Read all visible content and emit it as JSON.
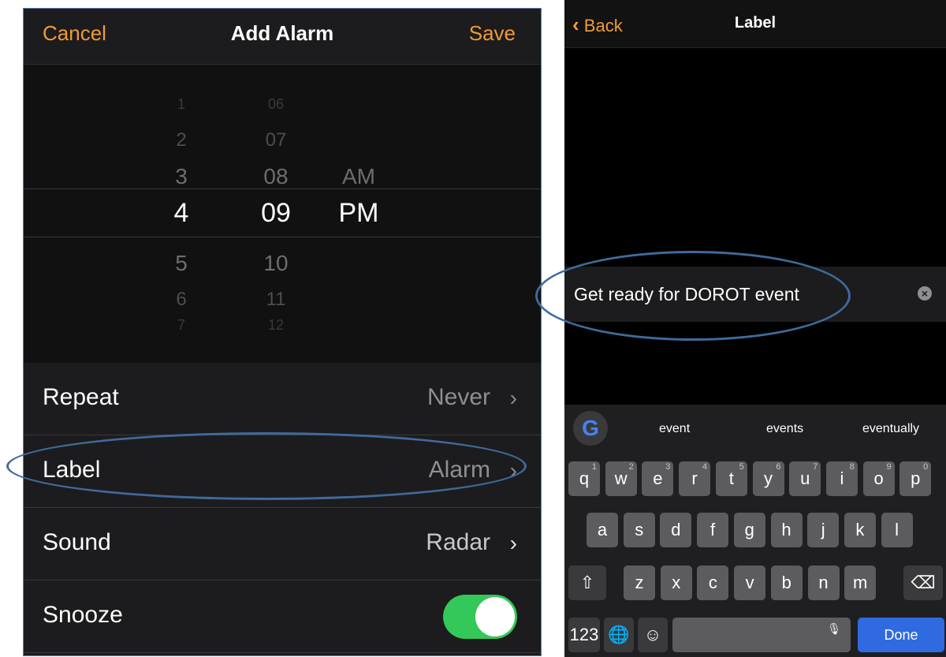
{
  "left": {
    "nav": {
      "cancel": "Cancel",
      "title": "Add Alarm",
      "save": "Save"
    },
    "picker": {
      "hours": [
        "1",
        "2",
        "3",
        "4",
        "5",
        "6",
        "7"
      ],
      "minutes": [
        "06",
        "07",
        "08",
        "09",
        "10",
        "11",
        "12"
      ],
      "period": [
        "AM",
        "PM"
      ],
      "selected": {
        "hour": "4",
        "minute": "09",
        "period": "PM"
      }
    },
    "rows": {
      "repeat": {
        "label": "Repeat",
        "value": "Never"
      },
      "label": {
        "label": "Label",
        "value": "Alarm"
      },
      "sound": {
        "label": "Sound",
        "value": "Radar"
      },
      "snooze": {
        "label": "Snooze",
        "enabled": true
      }
    }
  },
  "right": {
    "nav": {
      "back": "Back",
      "title": "Label"
    },
    "field": {
      "value": "Get ready for DOROT event"
    },
    "suggestions": [
      "event",
      "events",
      "eventually"
    ],
    "keyboard": {
      "row1": [
        [
          "q",
          "1"
        ],
        [
          "w",
          "2"
        ],
        [
          "e",
          "3"
        ],
        [
          "r",
          "4"
        ],
        [
          "t",
          "5"
        ],
        [
          "y",
          "6"
        ],
        [
          "u",
          "7"
        ],
        [
          "i",
          "8"
        ],
        [
          "o",
          "9"
        ],
        [
          "p",
          "0"
        ]
      ],
      "row2": [
        "a",
        "s",
        "d",
        "f",
        "g",
        "h",
        "j",
        "k",
        "l"
      ],
      "row3": [
        "z",
        "x",
        "c",
        "v",
        "b",
        "n",
        "m"
      ],
      "numbers": "123",
      "done": "Done"
    }
  },
  "colors": {
    "accent": "#f09a37",
    "toggle": "#34c759",
    "done": "#2f6ae0",
    "annotation": "#3f6a9c"
  },
  "icons": [
    "chevron-left-icon",
    "chevron-right-icon",
    "clear-icon",
    "google-icon",
    "shift-icon",
    "backspace-icon",
    "globe-icon",
    "emoji-icon",
    "mic-icon"
  ]
}
